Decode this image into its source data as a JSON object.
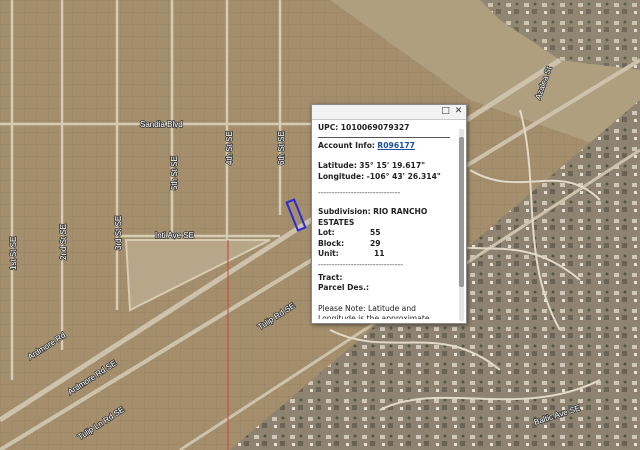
{
  "map": {
    "streets": [
      "Sandia Blvd",
      "Inti Ave SE",
      "4th St SE",
      "5th St SE",
      "6th St SE",
      "3rd St SE",
      "2nd St SE",
      "1st St SE",
      "Tulip Rd SE",
      "Ardmore Rd",
      "Ardmore Rd SE",
      "Tulip Ln Rd SE",
      "Baltic Ave SE",
      "Azalea St"
    ]
  },
  "popup": {
    "upc_label": "UPC:",
    "upc_value": "1010069079327",
    "account_label": "Account Info:",
    "account_link": "R096177",
    "latitude_label": "Latitude:",
    "latitude_value": "35° 15' 19.617\"",
    "longitude_label": "Longitude:",
    "longitude_value": "-106° 43' 26.314\"",
    "separator": "------------------------------",
    "subdivision_label": "Subdivision:",
    "subdivision_value": "RIO RANCHO ESTATES",
    "lot_label": "Lot:",
    "lot_value": "55",
    "block_label": "Block:",
    "block_value": "29",
    "unit_label": "Unit:",
    "unit_value": "11",
    "separator2": "-------------------------------",
    "tract_label": "Tract:",
    "parcel_label": "Parcel Des.:",
    "note": "Please Note: Latitude and Longitude is the approximate center of the parcel shown.",
    "maximize_icon": "maximize-icon",
    "close_icon": "close-icon"
  },
  "colors": {
    "ground": "#a58f6e",
    "road": "#d8cdb8",
    "parcel_highlight": "#2b2bd9",
    "link": "#1a4ea0"
  }
}
